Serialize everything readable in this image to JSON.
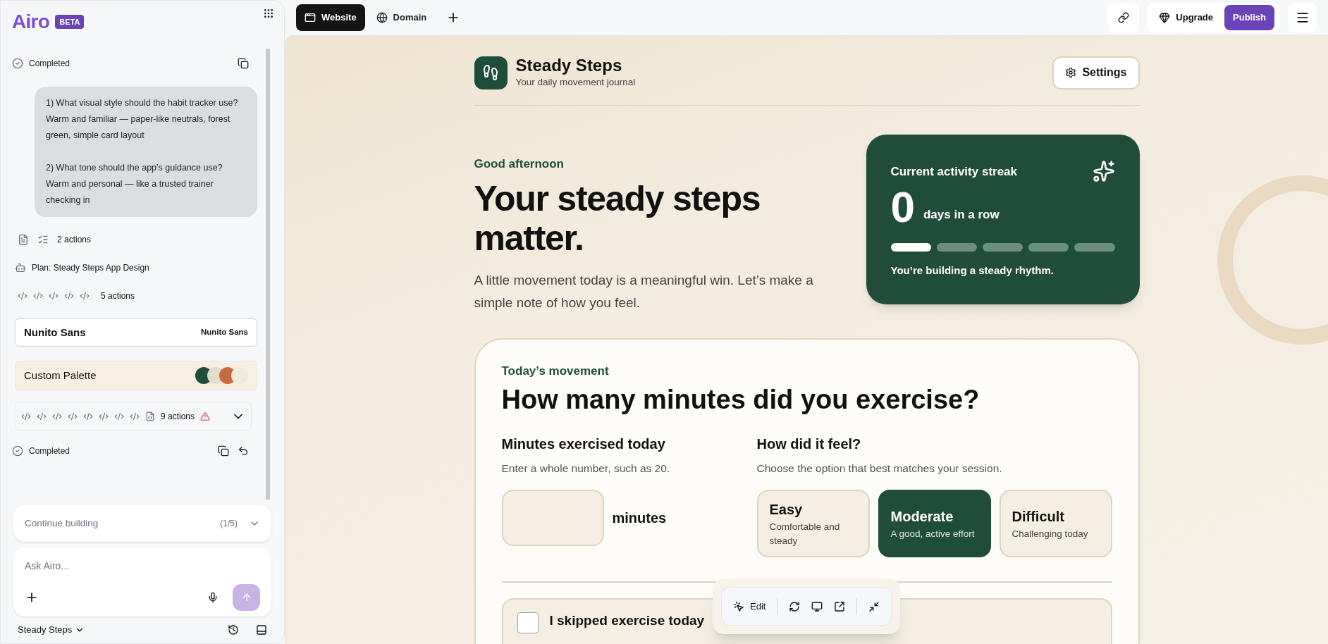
{
  "sidebar": {
    "logo": "Airo",
    "badge": "BETA",
    "feed": [
      {
        "kind": "status",
        "label": "Completed"
      },
      {
        "kind": "message",
        "paragraphs": [
          [
            "1) What visual style should the habit tracker use?",
            "Warm and familiar — paper-like neutrals, forest green, simple card layout"
          ],
          [
            "2) What tone should the app’s guidance use?",
            "Warm and personal — like a trusted trainer checking in"
          ]
        ]
      },
      {
        "kind": "actions",
        "label": "2 actions"
      },
      {
        "kind": "plan",
        "label": "Plan: Steady Steps App Design"
      },
      {
        "kind": "code",
        "label": "5 actions"
      },
      {
        "kind": "font",
        "label": "Nunito Sans",
        "value": "Nunito Sans"
      },
      {
        "kind": "palette",
        "label": "Custom Palette",
        "colors": [
          {
            "color": "#1f4d3a"
          },
          {
            "color": "#e6dccb"
          },
          {
            "color": "#c96a3d"
          },
          {
            "color": "#efe8dc"
          }
        ]
      },
      {
        "kind": "code_group",
        "label": "9 actions",
        "warning": true,
        "expanded": false
      },
      {
        "kind": "status",
        "label": "Completed",
        "undo": true
      }
    ],
    "continue": {
      "label": "Continue building",
      "count": "(1/5)"
    },
    "composer": {
      "placeholder": "Ask Airo..."
    },
    "project": "Steady Steps"
  },
  "topbar": {
    "tabs": [
      {
        "label": "Website",
        "selected": true
      },
      {
        "label": "Domain",
        "selected": false
      }
    ],
    "upgrade": "Upgrade",
    "publish": "Publish"
  },
  "app": {
    "name": "Steady Steps",
    "tagline": "Your daily movement journal",
    "settings": "Settings",
    "greeting": "Good afternoon",
    "headline": "Your steady steps matter.",
    "intro": "A little movement today is a meaningful win. Let’s make a simple note of how you feel.",
    "streak": {
      "title": "Current activity streak",
      "count": "0",
      "unit": "days in a row",
      "segments": [
        {
          "filled": true
        },
        {
          "filled": false
        },
        {
          "filled": false
        },
        {
          "filled": false
        },
        {
          "filled": false
        }
      ],
      "note": "You’re building a steady rhythm."
    },
    "form": {
      "eyebrow": "Today’s movement",
      "question": "How many minutes did you exercise?",
      "minutes_label": "Minutes exercised today",
      "minutes_hint": "Enter a whole number, such as 20.",
      "minutes_unit": "minutes",
      "feel_label": "How did it feel?",
      "feel_hint": "Choose the option that best matches your session.",
      "options": [
        {
          "title": "Easy",
          "desc": "Comfortable and steady",
          "selected": false
        },
        {
          "title": "Moderate",
          "desc": "A good, active effort",
          "selected": true
        },
        {
          "title": "Difficult",
          "desc": "Challenging today",
          "selected": false
        }
      ],
      "skip": {
        "label": "I skipped exercise today",
        "checked": false
      }
    }
  },
  "toolbar": {
    "edit": "Edit"
  }
}
